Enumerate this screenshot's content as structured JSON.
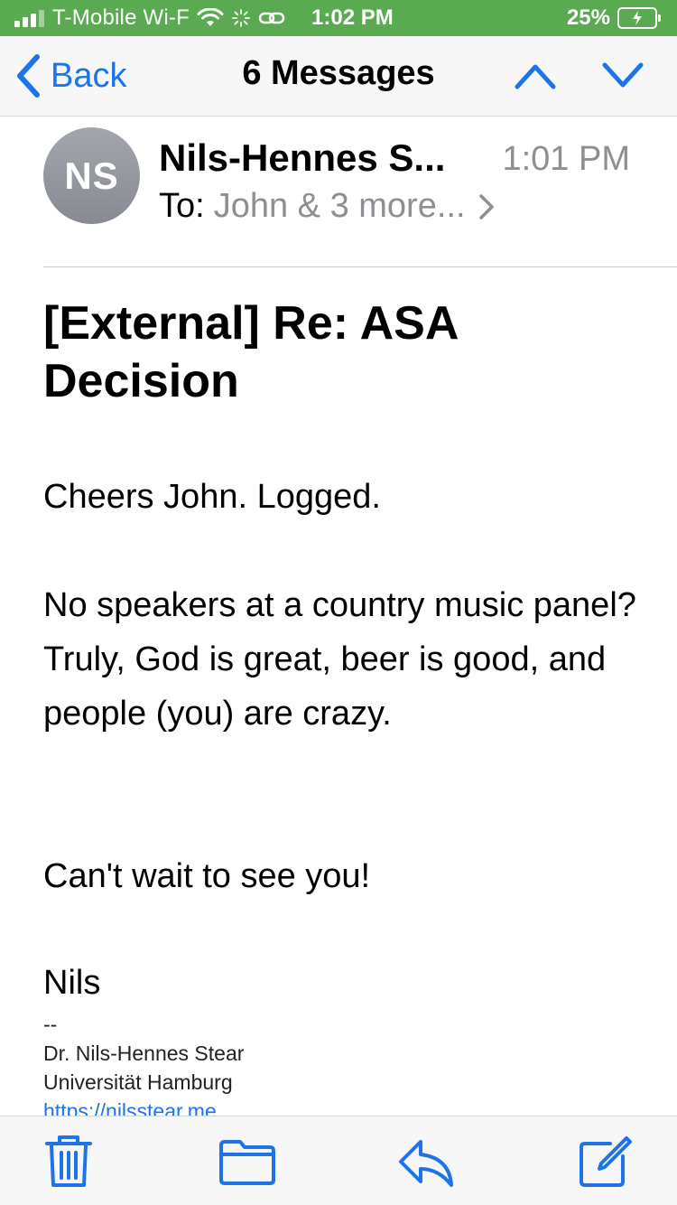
{
  "colors": {
    "status_bar_bg": "#5aaa51",
    "accent": "#1e73e8",
    "secondary_text": "#8e8e93",
    "avatar_bg": "#989aa1"
  },
  "status_bar": {
    "carrier": "T-Mobile Wi-F",
    "time": "1:02 PM",
    "battery": "25%",
    "icons": [
      "signal-icon",
      "wifi-icon",
      "activity-icon",
      "link-icon",
      "battery-charging-icon"
    ]
  },
  "nav": {
    "back_label": "Back",
    "title": "6 Messages"
  },
  "header": {
    "avatar_initials": "NS",
    "sender": "Nils-Hennes S...",
    "time": "1:01 PM",
    "to_label": "To:",
    "to_value": "John & 3 more..."
  },
  "message": {
    "subject": "[External] Re: ASA Decision",
    "paragraphs": [
      "Cheers John. Logged.",
      "No speakers at a country music panel? Truly, God is great, beer is good, and people (you) are crazy.",
      "Can't wait to see you!",
      "Nils"
    ],
    "signature": {
      "separator": "--",
      "name": "Dr. Nils-Hennes Stear",
      "affiliation": "Universität Hamburg",
      "link": "https://nilsstear.me"
    }
  },
  "toolbar": {
    "icons": [
      "trash-icon",
      "folder-icon",
      "reply-icon",
      "compose-icon"
    ]
  }
}
